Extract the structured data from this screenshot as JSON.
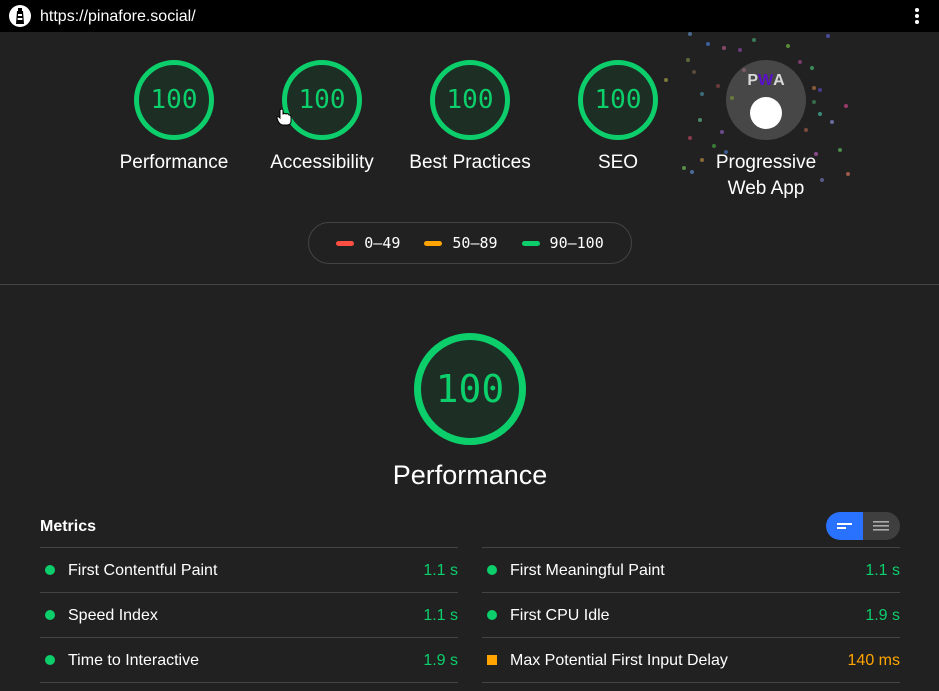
{
  "browser": {
    "url": "https://pinafore.social/"
  },
  "categories": [
    {
      "score": "100",
      "label": "Performance"
    },
    {
      "score": "100",
      "label": "Accessibility"
    },
    {
      "score": "100",
      "label": "Best Practices"
    },
    {
      "score": "100",
      "label": "SEO"
    }
  ],
  "pwa": {
    "badge_text_1": "P",
    "badge_text_2": "W",
    "badge_text_3": "A",
    "label_line1": "Progressive",
    "label_line2": "Web App"
  },
  "legend": [
    {
      "range": "0–49",
      "color": "#ff4e42"
    },
    {
      "range": "50–89",
      "color": "#ffa400"
    },
    {
      "range": "90–100",
      "color": "#0cce6b"
    }
  ],
  "performance": {
    "score": "100",
    "title": "Performance"
  },
  "metrics": {
    "header": "Metrics",
    "left": [
      {
        "name": "First Contentful Paint",
        "value": "1.1 s"
      },
      {
        "name": "Speed Index",
        "value": "1.1 s"
      },
      {
        "name": "Time to Interactive",
        "value": "1.9 s"
      }
    ],
    "right": [
      {
        "name": "First Meaningful Paint",
        "value": "1.1 s"
      },
      {
        "name": "First CPU Idle",
        "value": "1.9 s"
      },
      {
        "name": "Max Potential First Input Delay",
        "value": "140 ms"
      }
    ]
  },
  "colors": {
    "pass": "#0cce6b",
    "average": "#ffa400",
    "fail": "#ff4e42",
    "toggle_active": "#2972ff"
  }
}
